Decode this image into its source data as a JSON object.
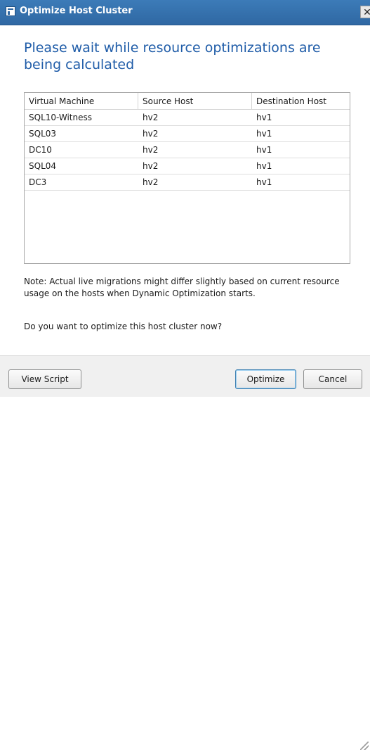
{
  "window": {
    "title": "Optimize Host Cluster",
    "close_glyph": "✕"
  },
  "heading": "Please wait while resource optimizations are being calculated",
  "table": {
    "columns": [
      "Virtual Machine",
      "Source Host",
      "Destination Host"
    ],
    "rows": [
      [
        "SQL10-Witness",
        "hv2",
        "hv1"
      ],
      [
        "SQL03",
        "hv2",
        "hv1"
      ],
      [
        "DC10",
        "hv2",
        "hv1"
      ],
      [
        "SQL04",
        "hv2",
        "hv1"
      ],
      [
        "DC3",
        "hv2",
        "hv1"
      ]
    ]
  },
  "note": "Note: Actual live migrations might differ slightly based on current resource usage on the hosts when Dynamic Optimization starts.",
  "question": "Do you want to optimize this host cluster now?",
  "buttons": {
    "view_script": "View Script",
    "optimize": "Optimize",
    "cancel": "Cancel"
  },
  "colors": {
    "titlebar": "#2f68a3",
    "heading": "#1f5ca8",
    "footer": "#f0f0f0"
  },
  "icons": [
    "app-window-icon",
    "close-icon",
    "resize-grip-icon"
  ]
}
